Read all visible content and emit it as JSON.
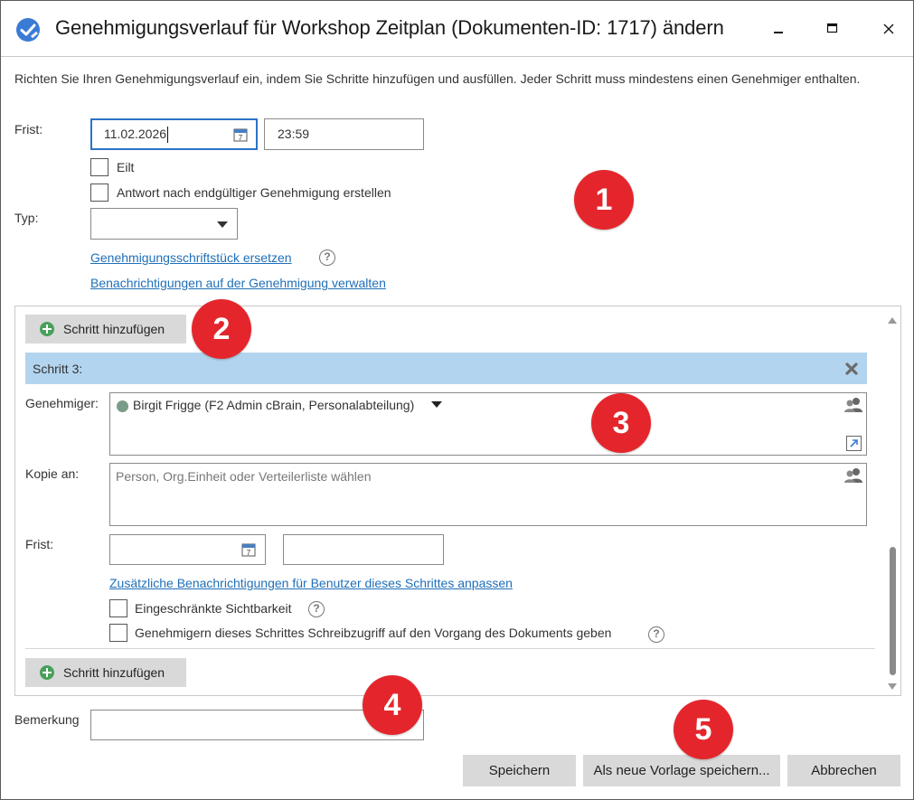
{
  "window": {
    "title": "Genehmigungsverlauf für Workshop Zeitplan (Dokumenten-ID: 1717) ändern",
    "accent_color": "#2b74c7"
  },
  "intro_text": "Richten Sie Ihren Genehmigungsverlauf ein, indem Sie Schritte hinzufügen und ausfüllen. Jeder Schritt muss mindestens einen Genehmiger enthalten.",
  "deadline": {
    "label": "Frist:",
    "date": "11.02.2026",
    "time": "23:59"
  },
  "urgent": {
    "label": "Eilt",
    "checked": false
  },
  "reply_after_approval": {
    "label": "Antwort nach endgültiger Genehmigung erstellen",
    "checked": false
  },
  "type": {
    "label": "Typ:",
    "value": ""
  },
  "links": {
    "replace_document": "Genehmigungsschriftstück ersetzen",
    "manage_notifications": "Benachrichtigungen auf der Genehmigung verwalten"
  },
  "steps_panel": {
    "add_step_label": "Schritt hinzufügen",
    "step": {
      "title": "Schritt 3:",
      "header_color": "#b3d4ee",
      "approver_label": "Genehmiger:",
      "approver_value": "Birgit Frigge (F2 Admin cBrain, Personalabteilung)",
      "copy_label": "Kopie an:",
      "copy_placeholder": "Person, Org.Einheit oder Verteilerliste wählen",
      "deadline_label": "Frist:",
      "deadline_date": "",
      "deadline_time": "",
      "notifications_link": "Zusätzliche Benachrichtigungen für Benutzer dieses Schrittes anpassen",
      "restricted_visibility": {
        "label": "Eingeschränkte Sichtbarkeit",
        "checked": false
      },
      "write_access": {
        "label": "Genehmigern dieses Schrittes Schreibzugriff auf den Vorgang des Dokuments geben",
        "checked": false
      }
    }
  },
  "remark": {
    "label": "Bemerkung",
    "value": ""
  },
  "buttons": {
    "save": "Speichern",
    "save_template": "Als neue Vorlage speichern...",
    "cancel": "Abbrechen"
  },
  "badges": [
    "1",
    "2",
    "3",
    "4",
    "5"
  ],
  "badge_color": "#e4262c"
}
